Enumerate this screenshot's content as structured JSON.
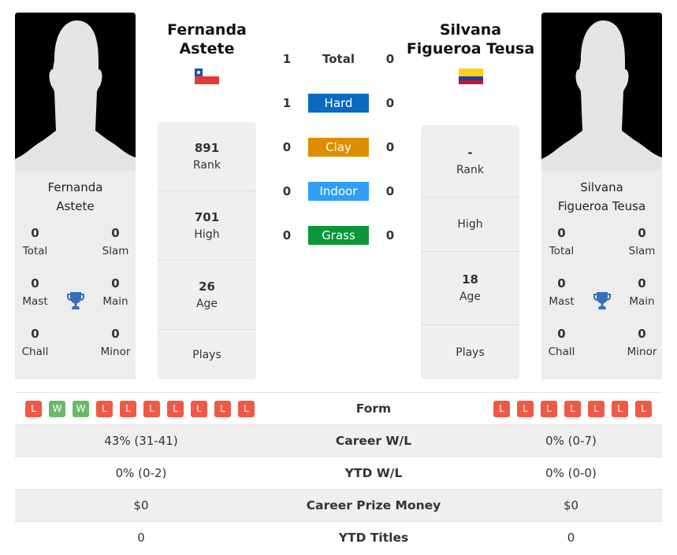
{
  "colors": {
    "hard": "#0a6abf",
    "clay": "#de8d00",
    "indoor": "#2f9ef5",
    "grass": "#0a9639",
    "loss": "#ee5a45",
    "win": "#6ab96a",
    "trophy": "#3a6fb7"
  },
  "player1": {
    "name_header": [
      "Fernanda",
      "Astete"
    ],
    "card_name": [
      "Fernanda",
      "Astete"
    ],
    "flag": "chile-flag",
    "titles": {
      "total": {
        "value": "0",
        "label": "Total"
      },
      "slam": {
        "value": "0",
        "label": "Slam"
      },
      "mast": {
        "value": "0",
        "label": "Mast"
      },
      "main": {
        "value": "0",
        "label": "Main"
      },
      "chall": {
        "value": "0",
        "label": "Chall"
      },
      "minor": {
        "value": "0",
        "label": "Minor"
      }
    },
    "stats": [
      {
        "value": "891",
        "label": "Rank"
      },
      {
        "value": "701",
        "label": "High"
      },
      {
        "value": "26",
        "label": "Age"
      },
      {
        "value": "",
        "label": "Plays"
      }
    ],
    "form": [
      "L",
      "W",
      "W",
      "L",
      "L",
      "L",
      "L",
      "L",
      "L",
      "L"
    ],
    "career_wl": "43% (31-41)",
    "ytd_wl": "0% (0-2)",
    "prize": "$0",
    "ytd_titles": "0"
  },
  "player2": {
    "name_header": [
      "Silvana",
      "Figueroa Teusa"
    ],
    "card_name": [
      "Silvana",
      "Figueroa Teusa"
    ],
    "flag": "colombia-flag",
    "titles": {
      "total": {
        "value": "0",
        "label": "Total"
      },
      "slam": {
        "value": "0",
        "label": "Slam"
      },
      "mast": {
        "value": "0",
        "label": "Mast"
      },
      "main": {
        "value": "0",
        "label": "Main"
      },
      "chall": {
        "value": "0",
        "label": "Chall"
      },
      "minor": {
        "value": "0",
        "label": "Minor"
      }
    },
    "stats": [
      {
        "value": "-",
        "label": "Rank"
      },
      {
        "value": "",
        "label": "High"
      },
      {
        "value": "18",
        "label": "Age"
      },
      {
        "value": "",
        "label": "Plays"
      }
    ],
    "form": [
      "L",
      "L",
      "L",
      "L",
      "L",
      "L",
      "L"
    ],
    "career_wl": "0% (0-7)",
    "ytd_wl": "0% (0-0)",
    "prize": "$0",
    "ytd_titles": "0"
  },
  "h2h": [
    {
      "label": "Total",
      "p1": "1",
      "p2": "0",
      "surface": "total"
    },
    {
      "label": "Hard",
      "p1": "1",
      "p2": "0",
      "surface": "hard"
    },
    {
      "label": "Clay",
      "p1": "0",
      "p2": "0",
      "surface": "clay"
    },
    {
      "label": "Indoor",
      "p1": "0",
      "p2": "0",
      "surface": "indoor"
    },
    {
      "label": "Grass",
      "p1": "0",
      "p2": "0",
      "surface": "grass"
    }
  ],
  "table_labels": {
    "form": "Form",
    "career_wl": "Career W/L",
    "ytd_wl": "YTD W/L",
    "prize": "Career Prize Money",
    "ytd_titles": "YTD Titles"
  }
}
